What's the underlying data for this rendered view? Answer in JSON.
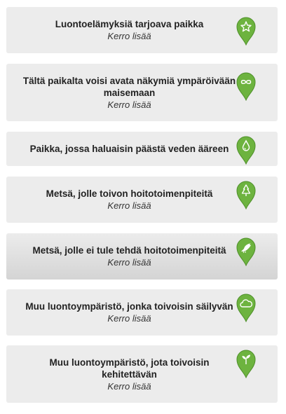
{
  "colors": {
    "card_bg": "#ececec",
    "pin_green": "#6db33f",
    "pin_green_dark": "#4e8f2a",
    "title_text": "#222222"
  },
  "items": [
    {
      "title": "Luontoelämyksiä tarjoava paikka",
      "more": "Kerro lisää",
      "icon": "star-icon"
    },
    {
      "title": "Tältä paikalta voisi avata näkymiä ympäröivään maisemaan",
      "more": "Kerro lisää",
      "icon": "infinity-icon"
    },
    {
      "title": "Paikka, jossa haluaisin päästä veden ääreen",
      "more": "",
      "icon": "water-drop-icon"
    },
    {
      "title": "Metsä, jolle toivon hoitotoimenpiteitä",
      "more": "Kerro lisää",
      "icon": "tree-icon"
    },
    {
      "title": "Metsä, jolle ei tule tehdä hoitotoimenpiteitä",
      "more": "Kerro lisää",
      "icon": "bird-icon",
      "selected": true
    },
    {
      "title": "Muu luontoympäristö, jonka toivoisin säilyvän",
      "more": "Kerro lisää",
      "icon": "cloud-icon"
    },
    {
      "title": "Muu luontoympäristö, jota toivoisin kehitettävän",
      "more": "Kerro lisää",
      "icon": "sprout-icon"
    }
  ]
}
